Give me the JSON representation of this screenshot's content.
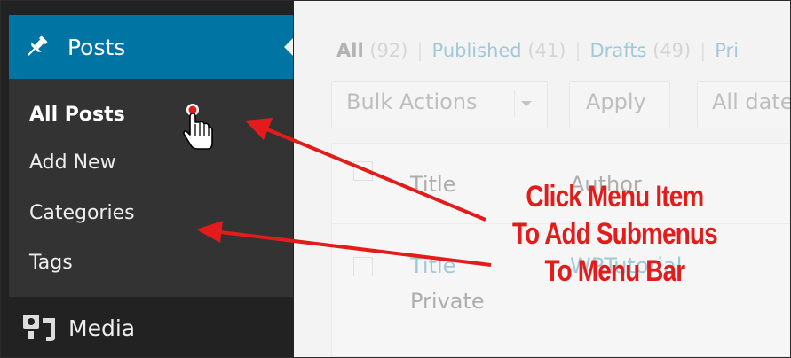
{
  "sidebar": {
    "posts_label": "Posts",
    "submenu": [
      "All Posts",
      "Add New",
      "Categories",
      "Tags"
    ],
    "media_label": "Media"
  },
  "main": {
    "filters": [
      {
        "label": "All",
        "count": "(92)"
      },
      {
        "label": "Published",
        "count": "(41)"
      },
      {
        "label": "Drafts",
        "count": "(49)"
      },
      {
        "label": "Pri",
        "count": ""
      }
    ],
    "bulk_actions": "Bulk Actions",
    "apply_label": "Apply",
    "date_filter": "All date",
    "columns": {
      "title": "Title",
      "author": "Author"
    },
    "row": {
      "title_line1": "Title",
      "title_line2": "Private",
      "author": "WPTutorial"
    }
  },
  "annotation": {
    "line1": "Click Menu Item",
    "line2": "To Add Submenus",
    "line3": "To Menu Bar",
    "color": "#e31b1b"
  },
  "colors": {
    "accent": "#0074a2",
    "sidebar_bg": "#222222",
    "submenu_bg": "#333333"
  }
}
